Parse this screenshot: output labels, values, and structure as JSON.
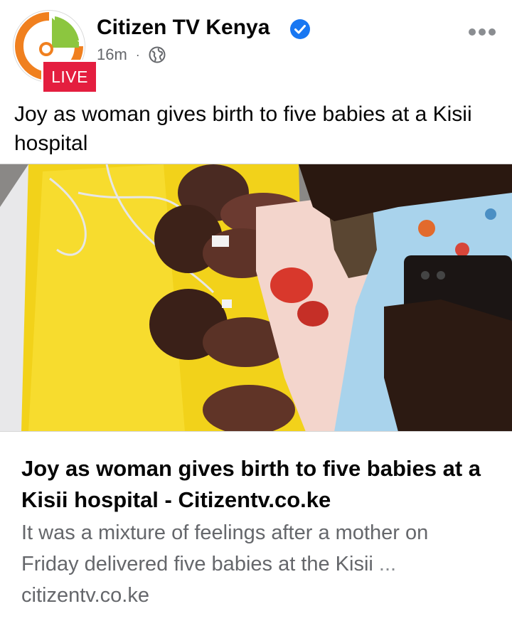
{
  "post": {
    "page_name": "Citizen TV Kenya",
    "live_badge": "LIVE",
    "timestamp": "16m",
    "separator": "·",
    "privacy_icon": "globe-icon",
    "verified_icon": "verified-badge-icon",
    "more_icon": "more-options-icon",
    "caption": "Joy as woman gives birth to five babies at a Kisii hospital"
  },
  "photo": {
    "icon": "newborn-photo"
  },
  "link_preview": {
    "title": "Joy as woman gives birth to five babies at a Kisii hospital - Citizentv.co.ke",
    "description": "It was a mixture of feelings after a mother on Friday delivered five babies at the Kisii",
    "ellipsis": "...",
    "domain": "citizentv.co.ke"
  },
  "colors": {
    "live_red": "#e41e3f",
    "verified_blue": "#1877f2",
    "secondary_text": "#65676b",
    "logo_orange": "#f0801f",
    "logo_green": "#8cc63f"
  }
}
